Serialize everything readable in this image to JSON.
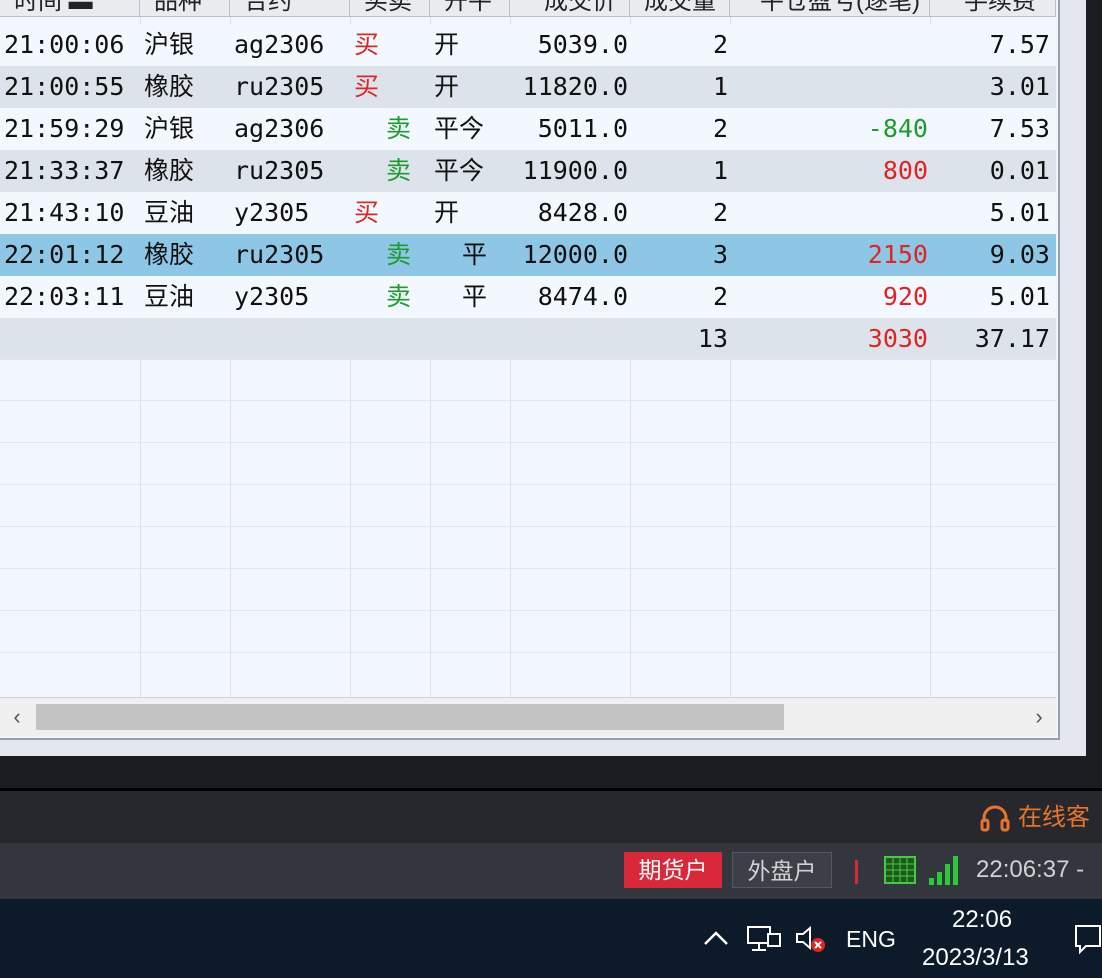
{
  "table": {
    "headers": [
      "时间",
      "品种",
      "合约",
      "买卖",
      "开平",
      "成交价",
      "成交量",
      "平仓盈亏(逐笔)",
      "手续费"
    ],
    "rows": [
      {
        "time": "21:00:06",
        "variety": "沪银",
        "contract": "ag2306",
        "side": "买",
        "open_close": "开",
        "price": "5039.0",
        "volume": "2",
        "pnl": "",
        "fee": "7.57"
      },
      {
        "time": "21:00:55",
        "variety": "橡胶",
        "contract": "ru2305",
        "side": "买",
        "open_close": "开",
        "price": "11820.0",
        "volume": "1",
        "pnl": "",
        "fee": "3.01"
      },
      {
        "time": "21:59:29",
        "variety": "沪银",
        "contract": "ag2306",
        "side": "卖",
        "open_close": "平今",
        "price": "5011.0",
        "volume": "2",
        "pnl": "-840",
        "fee": "7.53"
      },
      {
        "time": "21:33:37",
        "variety": "橡胶",
        "contract": "ru2305",
        "side": "卖",
        "open_close": "平今",
        "price": "11900.0",
        "volume": "1",
        "pnl": "800",
        "fee": "0.01"
      },
      {
        "time": "21:43:10",
        "variety": "豆油",
        "contract": "y2305",
        "side": "买",
        "open_close": "开",
        "price": "8428.0",
        "volume": "2",
        "pnl": "",
        "fee": "5.01"
      },
      {
        "time": "22:01:12",
        "variety": "橡胶",
        "contract": "ru2305",
        "side": "卖",
        "open_close": "平",
        "price": "12000.0",
        "volume": "3",
        "pnl": "2150",
        "fee": "9.03"
      },
      {
        "time": "22:03:11",
        "variety": "豆油",
        "contract": "y2305",
        "side": "卖",
        "open_close": "平",
        "price": "8474.0",
        "volume": "2",
        "pnl": "920",
        "fee": "5.01"
      }
    ],
    "selected_row": 5,
    "totals": {
      "volume": "13",
      "pnl": "3030",
      "fee": "37.17"
    }
  },
  "app_bar": {
    "service_text": "在线客",
    "account_tab_futures": "期货户",
    "account_tab_foreign": "外盘户",
    "status_time": "22:06:37 - "
  },
  "taskbar": {
    "language": "ENG",
    "clock_time": "22:06",
    "clock_date": "2023/3/13"
  },
  "colors": {
    "buy": "#e02424",
    "sell": "#1e9b2e",
    "selected_row": "#8ec6e6",
    "service": "#e8742c",
    "futures_tag": "#d8283a"
  }
}
